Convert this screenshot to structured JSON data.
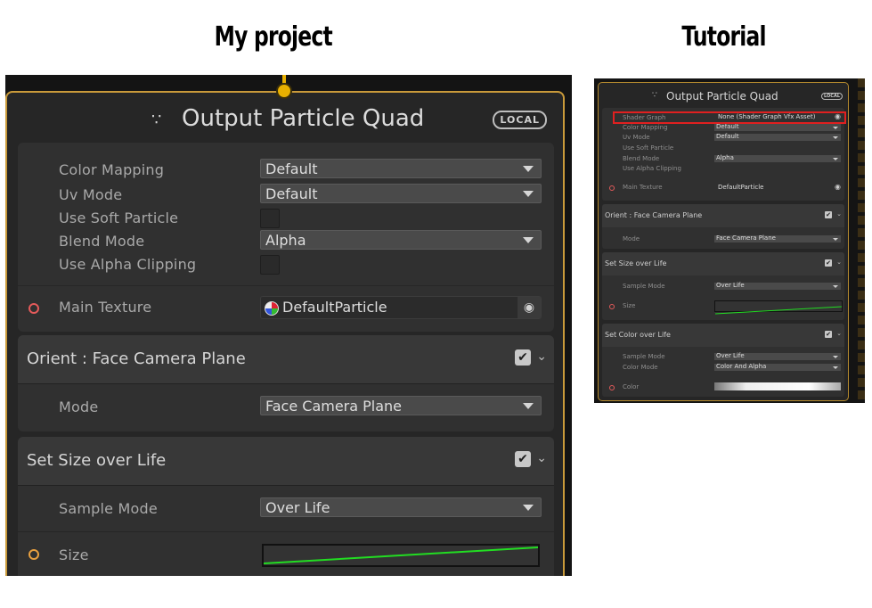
{
  "headings": {
    "left": "My project",
    "right": "Tutorial"
  },
  "left": {
    "title": "Output Particle Quad",
    "title_icon": "particle-system-icon",
    "badge": "LOCAL",
    "main": {
      "color_mapping": {
        "label": "Color Mapping",
        "value": "Default"
      },
      "uv_mode": {
        "label": "Uv Mode",
        "value": "Default"
      },
      "use_soft_particle": {
        "label": "Use Soft Particle"
      },
      "blend_mode": {
        "label": "Blend Mode",
        "value": "Alpha"
      },
      "use_alpha_clipping": {
        "label": "Use Alpha Clipping"
      },
      "main_texture": {
        "label": "Main Texture",
        "value": "DefaultParticle"
      }
    },
    "orient": {
      "title": "Orient : Face Camera Plane",
      "mode_label": "Mode",
      "mode_value": "Face Camera Plane"
    },
    "size_over_life": {
      "title": "Set Size over Life",
      "sample_label": "Sample Mode",
      "sample_value": "Over Life",
      "size_label": "Size"
    }
  },
  "right": {
    "title": "Output Particle Quad",
    "badge": "LOCAL",
    "main": [
      {
        "label": "Shader Graph",
        "value": "None (Shader Graph Vfx Asset)"
      },
      {
        "label": "Color Mapping",
        "value": "Default"
      },
      {
        "label": "Uv Mode",
        "value": "Default"
      },
      {
        "label": "Use Soft Particle",
        "value": ""
      },
      {
        "label": "Blend Mode",
        "value": "Alpha"
      },
      {
        "label": "Use Alpha Clipping",
        "value": ""
      }
    ],
    "main_texture": {
      "label": "Main Texture",
      "value": "DefaultParticle"
    },
    "orient": {
      "title": "Orient : Face Camera Plane",
      "mode_label": "Mode",
      "mode_value": "Face Camera Plane"
    },
    "size_over_life": {
      "title": "Set Size over Life",
      "sample_label": "Sample Mode",
      "sample_value": "Over Life",
      "size_label": "Size"
    },
    "color_over_life": {
      "title": "Set Color over Life",
      "sample_label": "Sample Mode",
      "sample_value": "Over Life",
      "color_mode_label": "Color Mode",
      "color_mode_value": "Color And Alpha",
      "color_label": "Color"
    }
  },
  "colors": {
    "port_ring": "#e45a5a",
    "port_ring_size": "#e8a040",
    "node_border": "#c99a3a",
    "curve": "#22dd22",
    "highlight": "#e02020"
  }
}
